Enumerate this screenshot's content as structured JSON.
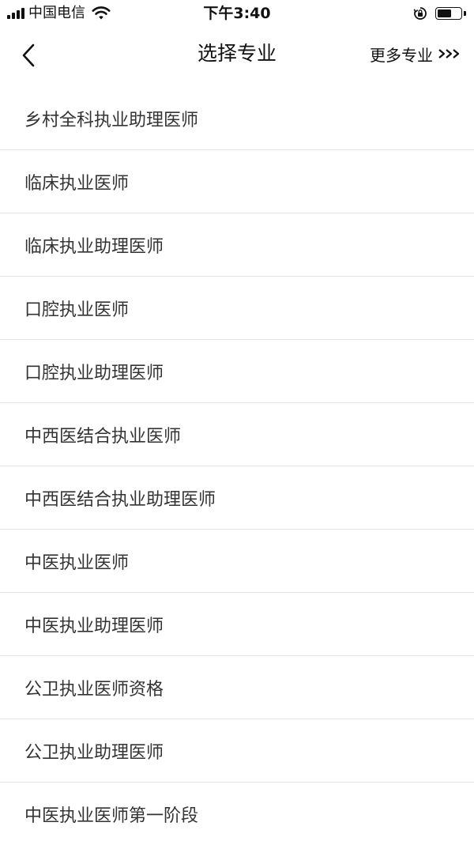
{
  "status_bar": {
    "carrier": "中国电信",
    "time": "下午3:40",
    "battery_level": 0.6
  },
  "nav": {
    "title": "选择专业",
    "more_label": "更多专业"
  },
  "majors": [
    "乡村全科执业助理医师",
    "临床执业医师",
    "临床执业助理医师",
    "口腔执业医师",
    "口腔执业助理医师",
    "中西医结合执业医师",
    "中西医结合执业助理医师",
    "中医执业医师",
    "中医执业助理医师",
    "公卫执业医师资格",
    "公卫执业助理医师",
    "中医执业医师第一阶段"
  ],
  "colors": {
    "text": "#333333",
    "divider": "#e6e6e6",
    "background": "#ffffff"
  }
}
